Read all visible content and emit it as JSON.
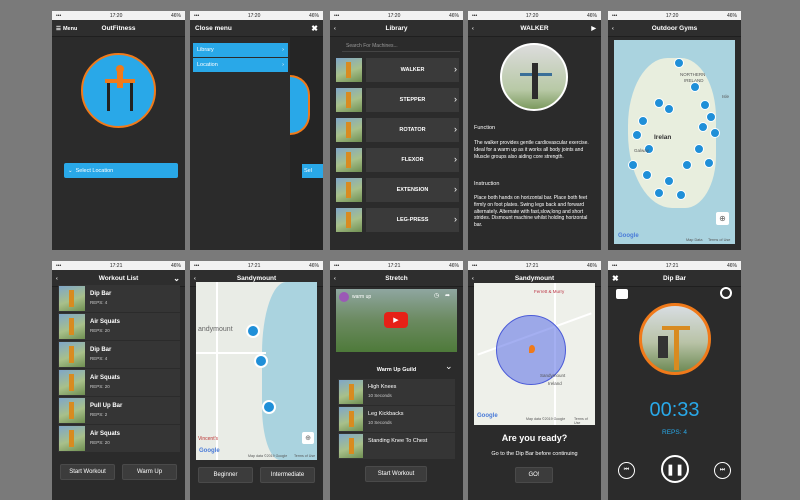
{
  "status": {
    "time1": "17:20",
    "time2": "17:21",
    "battery": "46%"
  },
  "s1": {
    "menu": "Menu",
    "title": "OutFitness",
    "select_location": "Select Location"
  },
  "s2": {
    "close_menu": "Close menu",
    "items": [
      {
        "label": "Library"
      },
      {
        "label": "Location"
      }
    ],
    "behind_select": "Sel"
  },
  "s3": {
    "title": "Library",
    "search_placeholder": "Search For Machines...",
    "items": [
      {
        "label": "WALKER"
      },
      {
        "label": "STEPPER"
      },
      {
        "label": "ROTATOR"
      },
      {
        "label": "FLEXOR"
      },
      {
        "label": "EXTENSION"
      },
      {
        "label": "LEG-PRESS"
      }
    ]
  },
  "s4": {
    "title": "WALKER",
    "function_heading": "Function",
    "function_text": "The walker provides gentle cardiovascular exercise. Ideal for a warm up as it works all body joints and Muscle groups also aiding core strength.",
    "instruction_heading": "Instruction",
    "instruction_text": "Place both hands on horizontal bar. Place both feet firmly on foot plates. Swing legs back and forward alternately. Alternate with fast,slow,long and short strides. Dismount machine whilst holding horizontal bar."
  },
  "s5": {
    "title": "Outdoor Gyms",
    "labels": {
      "northern": "NORTHERN",
      "ireland": "IRELAND",
      "isle": "Isle",
      "galway": "Galway",
      "irel": "Irelan",
      "google": "Google",
      "mapdata": "Map Data",
      "terms": "Terms of Use"
    }
  },
  "s6": {
    "title": "Workout List",
    "start": "Start Workout",
    "warm": "Warm Up",
    "items": [
      {
        "name": "Dip Bar",
        "reps": "REPS: 4"
      },
      {
        "name": "Air Squats",
        "reps": "REPS: 20"
      },
      {
        "name": "Dip Bar",
        "reps": "REPS: 4"
      },
      {
        "name": "Air Squats",
        "reps": "REPS: 20"
      },
      {
        "name": "Pull Up Bar",
        "reps": "REPS: 2"
      },
      {
        "name": "Air Squats",
        "reps": "REPS: 20"
      }
    ]
  },
  "s7": {
    "title": "Sandymount",
    "map_label": "andymount",
    "vincent": "Vincent's",
    "beginner": "Beginner",
    "intermediate": "Intermediate",
    "google": "Google",
    "mapdata": "Map data ©2019 Google",
    "terms": "Terms of Use"
  },
  "s8": {
    "title": "Stretch",
    "video_title": "warm up",
    "section": "Warm Up Guild",
    "start": "Start Workout",
    "items": [
      {
        "name": "High Knees",
        "dur": "10 Seconds"
      },
      {
        "name": "Leg Kickbacks",
        "dur": "10 Seconds"
      },
      {
        "name": "Standing Knee To Chest",
        "dur": ""
      }
    ]
  },
  "s9": {
    "title": "Sandymount",
    "ready": "Are you ready?",
    "instruction": "Go to the Dip Bar before continuing",
    "go": "GO!",
    "map_labels": {
      "ferrett": "Ferrett & Murry",
      "sandymount": "Sandymount",
      "ireland": "Ireland",
      "google": "Google",
      "mapdata": "Map data ©2019 Google",
      "terms": "Terms of Use"
    }
  },
  "s10": {
    "title": "Dip Bar",
    "timer": "00:33",
    "reps": "REPS: 4"
  },
  "colors": {
    "accent": "#29a8e8",
    "orange": "#f07a1a",
    "bg": "#7a7a7a",
    "panel": "#2b2b2b"
  }
}
